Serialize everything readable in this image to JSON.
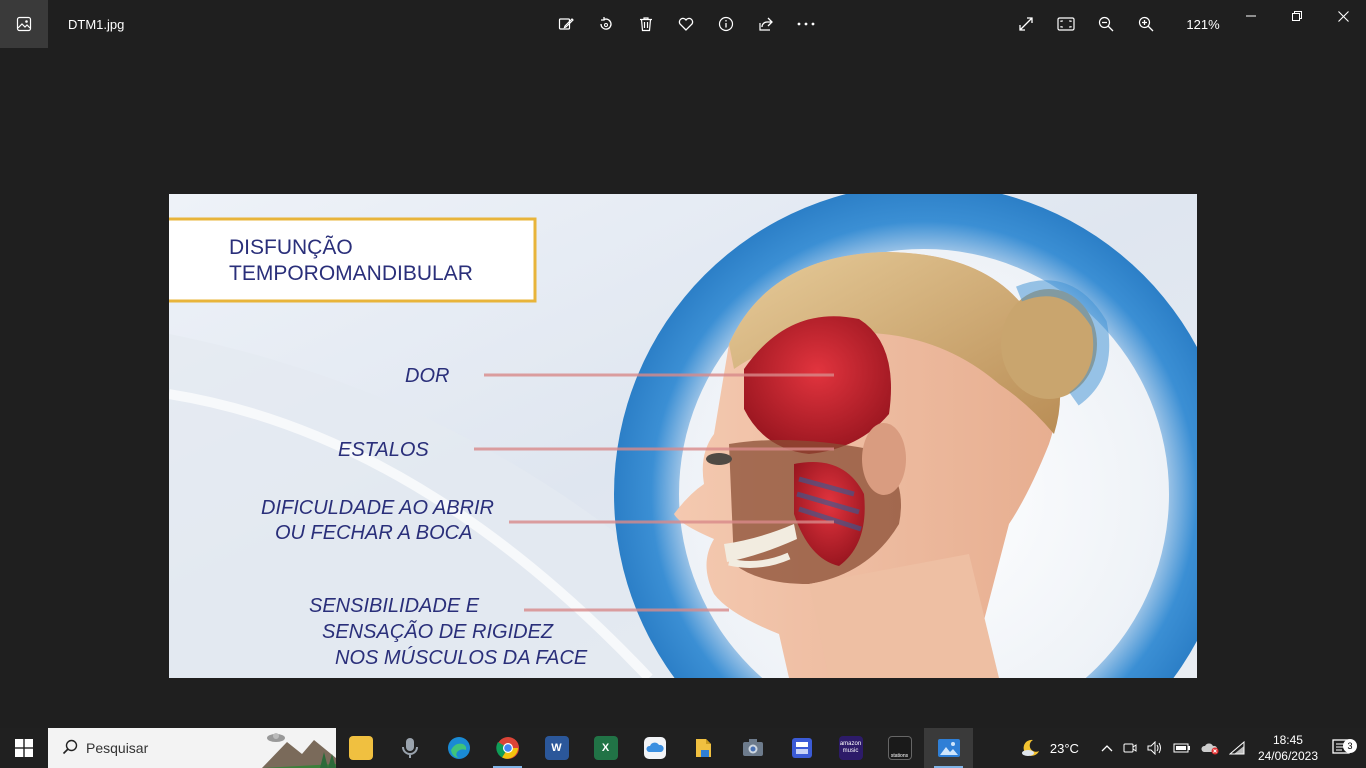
{
  "titlebar": {
    "file_name": "DTM1.jpg",
    "zoom": "121%",
    "toolbar_icons": [
      "edit-icon",
      "rotate-icon",
      "delete-icon",
      "favorite-icon",
      "info-icon",
      "share-icon",
      "more-icon"
    ],
    "view_icons": [
      "expand-icon",
      "fit-icon",
      "zoom-out-icon",
      "zoom-in-icon"
    ],
    "window_controls": [
      "minimize-icon",
      "restore-icon",
      "close-icon"
    ]
  },
  "image": {
    "title_line1": "DISFUNÇÃO",
    "title_line2": "TEMPOROMANDIBULAR",
    "symptom1": "DOR",
    "symptom2": "ESTALOS",
    "symptom3_line1": "DIFICULDADE AO ABRIR",
    "symptom3_line2": "OU FECHAR A BOCA",
    "symptom4_line1": "SENSIBILIDADE E",
    "symptom4_line2": "SENSAÇÃO DE RIGIDEZ",
    "symptom4_line3": "NOS MÚSCULOS DA FACE",
    "colors": {
      "title_box": "#e8b43a",
      "text": "#2a2f7a",
      "ring": "#3b8fd4"
    }
  },
  "taskbar": {
    "search_placeholder": "Pesquisar",
    "apps": [
      "file-explorer",
      "voice-recorder",
      "edge",
      "chrome",
      "word",
      "excel",
      "icloud",
      "files",
      "camera",
      "scanner",
      "amazon-music",
      "stations",
      "photos"
    ],
    "amazon_label": "amazon music",
    "stations_label": "stations",
    "weather": "23°C",
    "time": "18:45",
    "date": "24/06/2023",
    "notifications": "3"
  }
}
